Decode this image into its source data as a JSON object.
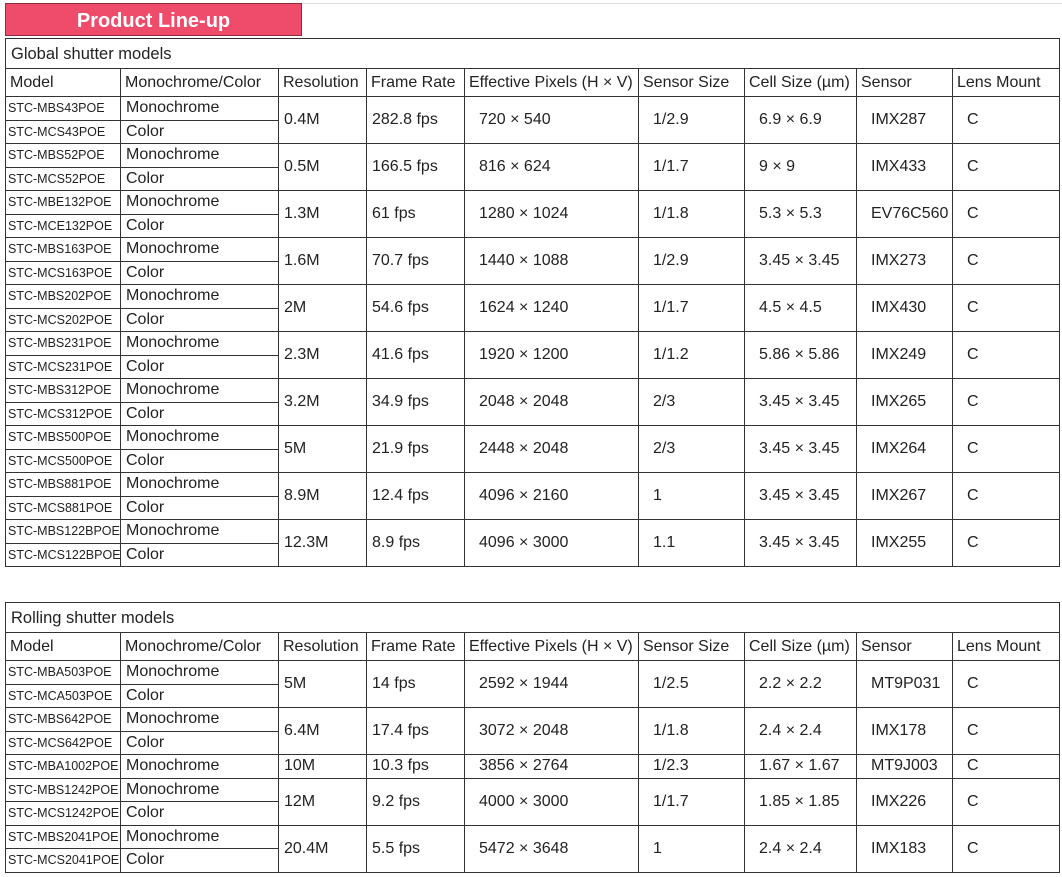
{
  "title": "Product Line-up",
  "headers": [
    "Model",
    "Monochrome/Color",
    "Resolution",
    "Frame Rate",
    "Effective Pixels (H × V)",
    "Sensor Size",
    "Cell Size (µm)",
    "Sensor",
    "Lens Mount"
  ],
  "global": {
    "label": "Global shutter models",
    "groups": [
      {
        "models": [
          [
            "STC-MBS43POE",
            "Monochrome"
          ],
          [
            "STC-MCS43POE",
            "Color"
          ]
        ],
        "resolution": "0.4M",
        "frame_rate": "282.8 fps",
        "pixels": "720 × 540",
        "sensor_size": "1/2.9",
        "cell": "6.9 × 6.9",
        "sensor": "IMX287",
        "mount": "C"
      },
      {
        "models": [
          [
            "STC-MBS52POE",
            "Monochrome"
          ],
          [
            "STC-MCS52POE",
            "Color"
          ]
        ],
        "resolution": "0.5M",
        "frame_rate": "166.5 fps",
        "pixels": "816 × 624",
        "sensor_size": "1/1.7",
        "cell": "9 × 9",
        "sensor": "IMX433",
        "mount": "C"
      },
      {
        "models": [
          [
            "STC-MBE132POE",
            "Monochrome"
          ],
          [
            "STC-MCE132POE",
            "Color"
          ]
        ],
        "resolution": "1.3M",
        "frame_rate": "61 fps",
        "pixels": "1280 × 1024",
        "sensor_size": "1/1.8",
        "cell": "5.3 × 5.3",
        "sensor": "EV76C560",
        "mount": "C"
      },
      {
        "models": [
          [
            "STC-MBS163POE",
            "Monochrome"
          ],
          [
            "STC-MCS163POE",
            "Color"
          ]
        ],
        "resolution": "1.6M",
        "frame_rate": "70.7 fps",
        "pixels": "1440 × 1088",
        "sensor_size": "1/2.9",
        "cell": "3.45 × 3.45",
        "sensor": "IMX273",
        "mount": "C"
      },
      {
        "models": [
          [
            "STC-MBS202POE",
            "Monochrome"
          ],
          [
            "STC-MCS202POE",
            "Color"
          ]
        ],
        "resolution": "2M",
        "frame_rate": "54.6 fps",
        "pixels": "1624 × 1240",
        "sensor_size": "1/1.7",
        "cell": "4.5 × 4.5",
        "sensor": "IMX430",
        "mount": "C"
      },
      {
        "models": [
          [
            "STC-MBS231POE",
            "Monochrome"
          ],
          [
            "STC-MCS231POE",
            "Color"
          ]
        ],
        "resolution": "2.3M",
        "frame_rate": "41.6 fps",
        "pixels": "1920 × 1200",
        "sensor_size": "1/1.2",
        "cell": "5.86 × 5.86",
        "sensor": "IMX249",
        "mount": "C"
      },
      {
        "models": [
          [
            "STC-MBS312POE",
            "Monochrome"
          ],
          [
            "STC-MCS312POE",
            "Color"
          ]
        ],
        "resolution": "3.2M",
        "frame_rate": "34.9 fps",
        "pixels": "2048 × 2048",
        "sensor_size": "2/3",
        "cell": "3.45 × 3.45",
        "sensor": "IMX265",
        "mount": "C"
      },
      {
        "models": [
          [
            "STC-MBS500POE",
            "Monochrome"
          ],
          [
            "STC-MCS500POE",
            "Color"
          ]
        ],
        "resolution": "5M",
        "frame_rate": "21.9 fps",
        "pixels": "2448 × 2048",
        "sensor_size": "2/3",
        "cell": "3.45 × 3.45",
        "sensor": "IMX264",
        "mount": "C"
      },
      {
        "models": [
          [
            "STC-MBS881POE",
            "Monochrome"
          ],
          [
            "STC-MCS881POE",
            "Color"
          ]
        ],
        "resolution": "8.9M",
        "frame_rate": "12.4 fps",
        "pixels": "4096 × 2160",
        "sensor_size": "1",
        "cell": "3.45 × 3.45",
        "sensor": "IMX267",
        "mount": "C"
      },
      {
        "models": [
          [
            "STC-MBS122BPOE",
            "Monochrome"
          ],
          [
            "STC-MCS122BPOE",
            "Color"
          ]
        ],
        "resolution": "12.3M",
        "frame_rate": "8.9 fps",
        "pixels": "4096 × 3000",
        "sensor_size": "1.1",
        "cell": "3.45 × 3.45",
        "sensor": "IMX255",
        "mount": "C"
      }
    ]
  },
  "rolling": {
    "label": "Rolling shutter models",
    "groups": [
      {
        "models": [
          [
            "STC-MBA503POE",
            "Monochrome"
          ],
          [
            "STC-MCA503POE",
            "Color"
          ]
        ],
        "resolution": "5M",
        "frame_rate": "14 fps",
        "pixels": "2592 × 1944",
        "sensor_size": "1/2.5",
        "cell": "2.2 × 2.2",
        "sensor": "MT9P031",
        "mount": "C"
      },
      {
        "models": [
          [
            "STC-MBS642POE",
            "Monochrome"
          ],
          [
            "STC-MCS642POE",
            "Color"
          ]
        ],
        "resolution": "6.4M",
        "frame_rate": "17.4 fps",
        "pixels": "3072 × 2048",
        "sensor_size": "1/1.8",
        "cell": "2.4 × 2.4",
        "sensor": "IMX178",
        "mount": "C"
      },
      {
        "models": [
          [
            "STC-MBA1002POE",
            "Monochrome"
          ]
        ],
        "resolution": "10M",
        "frame_rate": "10.3 fps",
        "pixels": "3856 × 2764",
        "sensor_size": "1/2.3",
        "cell": "1.67 × 1.67",
        "sensor": "MT9J003",
        "mount": "C"
      },
      {
        "models": [
          [
            "STC-MBS1242POE",
            "Monochrome"
          ],
          [
            "STC-MCS1242POE",
            "Color"
          ]
        ],
        "resolution": "12M",
        "frame_rate": "9.2 fps",
        "pixels": "4000 × 3000",
        "sensor_size": "1/1.7",
        "cell": "1.85 × 1.85",
        "sensor": "IMX226",
        "mount": "C"
      },
      {
        "models": [
          [
            "STC-MBS2041POE",
            "Monochrome"
          ],
          [
            "STC-MCS2041POE",
            "Color"
          ]
        ],
        "resolution": "20.4M",
        "frame_rate": "5.5 fps",
        "pixels": "5472 × 3648",
        "sensor_size": "1",
        "cell": "2.4 × 2.4",
        "sensor": "IMX183",
        "mount": "C"
      }
    ]
  }
}
